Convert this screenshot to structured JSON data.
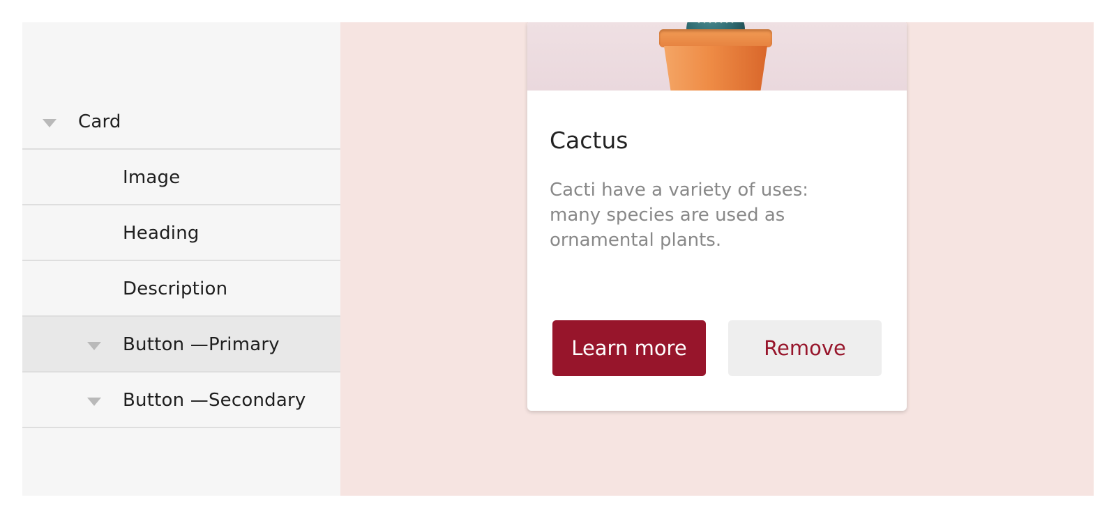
{
  "layer_tree": {
    "items": [
      {
        "label": "Card",
        "level": 0,
        "expandable": true,
        "selected": false
      },
      {
        "label": "Image",
        "level": 1,
        "expandable": false,
        "selected": false
      },
      {
        "label": "Heading",
        "level": 1,
        "expandable": false,
        "selected": false
      },
      {
        "label": "Description",
        "level": 1,
        "expandable": false,
        "selected": false
      },
      {
        "label": "Button —Primary",
        "level": 1,
        "expandable": true,
        "selected": true
      },
      {
        "label": "Button —Secondary",
        "level": 1,
        "expandable": true,
        "selected": false
      }
    ]
  },
  "card": {
    "image_icon": "cactus-in-pot",
    "heading": "Cactus",
    "description": "Cacti have a variety of uses: many species are used as ornamental plants.",
    "primary_button": "Learn more",
    "secondary_button": "Remove"
  },
  "colors": {
    "canvas_bg": "#f6e4e1",
    "sidebar_bg": "#f6f6f6",
    "selected_row_bg": "#e8e8e8",
    "accent": "#97152b",
    "secondary_button_bg": "#eeeeee",
    "description_text": "#888888"
  }
}
